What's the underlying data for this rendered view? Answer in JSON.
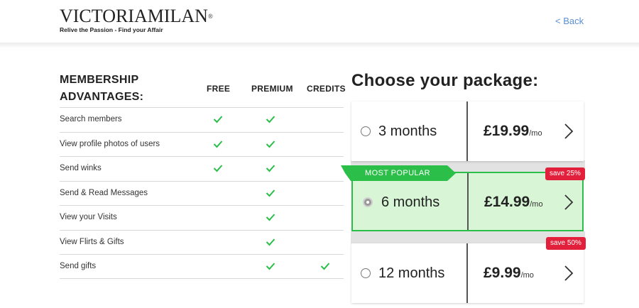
{
  "header": {
    "logo_text": "VICTORIAMILAN",
    "logo_reg": "®",
    "tagline": "Relive the Passion - Find your Affair",
    "back_label": "< Back"
  },
  "advantages": {
    "title": "MEMBERSHIP ADVANTAGES:",
    "columns": [
      "FREE",
      "PREMIUM",
      "CREDITS"
    ],
    "rows": [
      {
        "label": "Search members",
        "free": true,
        "premium": true,
        "credits": false
      },
      {
        "label": "View profile photos of users",
        "free": true,
        "premium": true,
        "credits": false
      },
      {
        "label": "Send winks",
        "free": true,
        "premium": true,
        "credits": false
      },
      {
        "label": "Send & Read Messages",
        "free": false,
        "premium": true,
        "credits": false
      },
      {
        "label": "View your Visits",
        "free": false,
        "premium": true,
        "credits": false
      },
      {
        "label": "View Flirts & Gifts",
        "free": false,
        "premium": true,
        "credits": false
      },
      {
        "label": "Send gifts",
        "free": false,
        "premium": true,
        "credits": true
      }
    ]
  },
  "packages": {
    "title": "Choose your package:",
    "ribbon": "MOST POPULAR",
    "items": [
      {
        "duration": "3 months",
        "price": "£19.99",
        "per": "/mo",
        "badge": ""
      },
      {
        "duration": "6 months",
        "price": "£14.99",
        "per": "/mo",
        "badge": "save 25%"
      },
      {
        "duration": "12 months",
        "price": "£9.99",
        "per": "/mo",
        "badge": "save 50%"
      }
    ]
  },
  "colors": {
    "accent_green": "#2bbf4a",
    "selected_bg": "#d8f5d6",
    "badge_red": "#e3203c",
    "link_blue": "#5a8fd6"
  }
}
